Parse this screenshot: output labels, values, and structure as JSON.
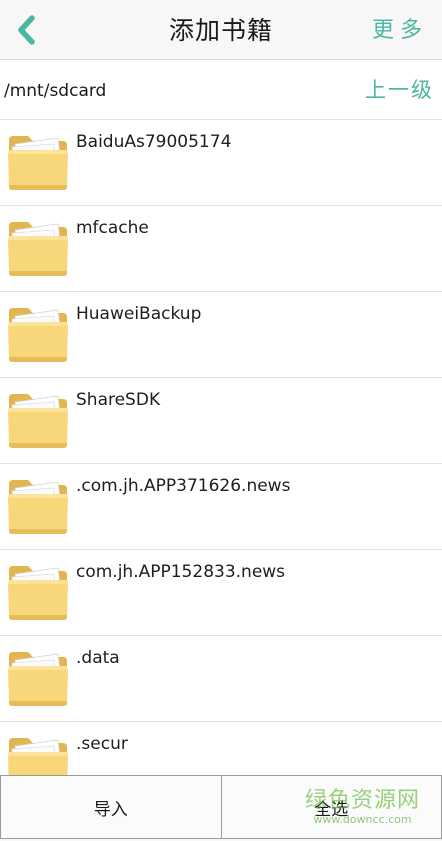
{
  "header": {
    "title": "添加书籍",
    "more_label": "更多"
  },
  "pathbar": {
    "path": "/mnt/sdcard",
    "up_label": "上一级"
  },
  "folders": [
    {
      "name": ""
    },
    {
      "name": "BaiduAs79005174"
    },
    {
      "name": "mfcache"
    },
    {
      "name": "HuaweiBackup"
    },
    {
      "name": "ShareSDK"
    },
    {
      "name": ".com.jh.APP371626.news"
    },
    {
      "name": "com.jh.APP152833.news"
    },
    {
      "name": ".data"
    },
    {
      "name": ".secur"
    }
  ],
  "bottom": {
    "import_label": "导入",
    "select_all_label": "全选"
  },
  "watermark": {
    "main": "绿色资源网",
    "sub": "www.downcc.com"
  },
  "colors": {
    "accent": "#4bb7a3",
    "folder_body": "#f8d77a",
    "folder_back": "#e2b54f"
  },
  "icons": {
    "back": "chevron-left-icon",
    "folder": "folder-icon"
  }
}
